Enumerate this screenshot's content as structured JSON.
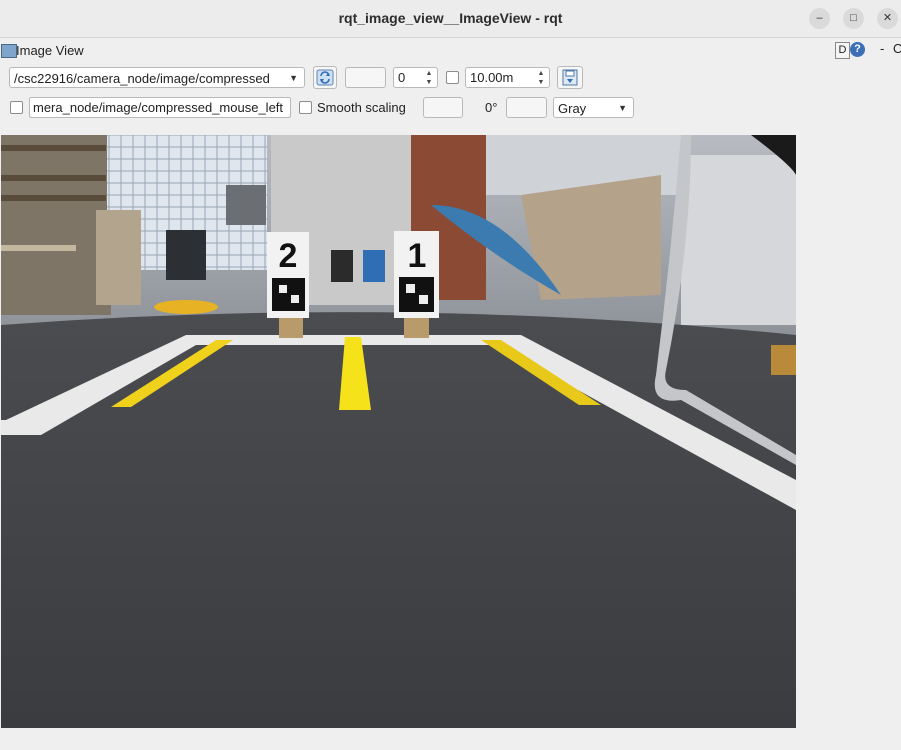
{
  "window": {
    "title": "rqt_image_view__ImageView - rqt",
    "minimize_glyph": "–",
    "maximize_glyph": "□",
    "close_glyph": "✕"
  },
  "plugin": {
    "title": "Image View",
    "d_label": "D",
    "help_label": "?",
    "dash_label": "-",
    "close_label": "O"
  },
  "toolbar": {
    "topic": "/csc22916/camera_node/image/compressed",
    "spin_value": "0",
    "max_range": "10.00m",
    "mouse_topic": "mera_node/image/compressed_mouse_left",
    "smooth_scaling_label": "Smooth scaling",
    "rotation": "0°",
    "color_scheme": "Gray"
  },
  "scene": {
    "tag_left": "2",
    "tag_right": "1"
  },
  "icons": {
    "refresh": "refresh-icon",
    "save": "save-icon",
    "plugin": "image-view-icon"
  }
}
